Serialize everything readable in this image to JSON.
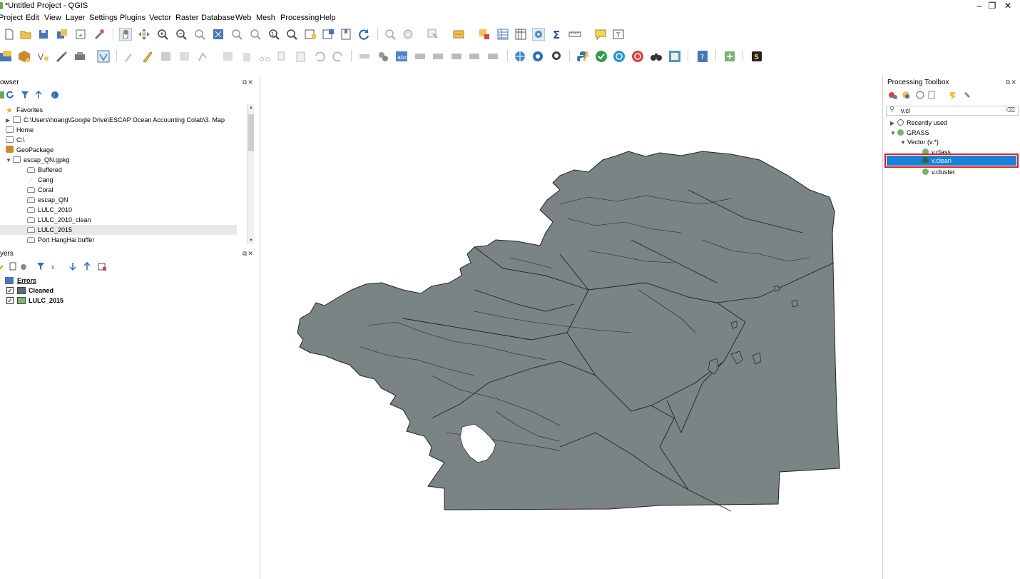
{
  "window": {
    "title": "*Untitled Project - QGIS",
    "minimize": "–",
    "restore": "❐",
    "close": "✕"
  },
  "menu": [
    "Project",
    "Edit",
    "View",
    "Layer",
    "Settings",
    "Plugins",
    "Vector",
    "Raster",
    "Database",
    "Web",
    "Mesh",
    "Processing",
    "Help"
  ],
  "browser": {
    "title": "owser",
    "items": [
      {
        "label": "Favorites",
        "icon": "star-icon"
      },
      {
        "label": "C:\\Users\\hoang\\Google Drive\\ESCAP Ocean Accounting Colab\\3. Map",
        "icon": "folder-icon"
      },
      {
        "label": "Home",
        "icon": "home-icon"
      },
      {
        "label": "C:\\",
        "icon": "folder-icon"
      },
      {
        "label": "GeoPackage",
        "icon": "geopackage-icon"
      },
      {
        "label": "escap_QN.gpkg",
        "icon": "database-icon"
      },
      {
        "label": "Buffered",
        "icon": "polygon-layer-icon"
      },
      {
        "label": "Cang",
        "icon": "point-layer-icon"
      },
      {
        "label": "Coral",
        "icon": "polygon-layer-icon"
      },
      {
        "label": "escap_QN",
        "icon": "polygon-layer-icon"
      },
      {
        "label": "LULC_2010",
        "icon": "polygon-layer-icon"
      },
      {
        "label": "LULC_2010_clean",
        "icon": "polygon-layer-icon"
      },
      {
        "label": "LULC_2015",
        "icon": "polygon-layer-icon"
      },
      {
        "label": "Port HangHai buffer",
        "icon": "polygon-layer-icon"
      }
    ]
  },
  "layers": {
    "title": "yers",
    "items": [
      {
        "label": "Errors",
        "checked": false,
        "color": "",
        "is_group": true
      },
      {
        "label": "Cleaned",
        "checked": true,
        "color": "#5f6b6e"
      },
      {
        "label": "LULC_2015",
        "checked": true,
        "color": "#7fb86c"
      }
    ]
  },
  "map": {
    "fill_color": "#7b8485",
    "stroke_color": "#1f2324"
  },
  "toolbox": {
    "title": "Processing Toolbox",
    "search_value": "v.cl",
    "tree": [
      {
        "label": "Recently used",
        "icon": "clock-icon"
      },
      {
        "label": "GRASS",
        "icon": "grass-icon"
      },
      {
        "label": "Vector (v.*)",
        "icon": ""
      },
      {
        "label": "v.class",
        "icon": "grass-icon"
      },
      {
        "label": "v.clean",
        "icon": "grass-icon",
        "selected": true
      },
      {
        "label": "v.cluster",
        "icon": "grass-icon"
      }
    ]
  },
  "accent": {
    "selection": "#1c7fd6",
    "highlight_border": "#e02020"
  }
}
